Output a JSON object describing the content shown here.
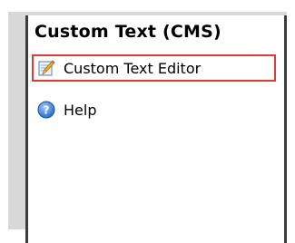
{
  "panel": {
    "title": "Custom Text (CMS)"
  },
  "menu": {
    "items": [
      {
        "label": "Custom Text Editor",
        "icon": "pencil-edit-icon",
        "selected": true
      },
      {
        "label": "Help",
        "icon": "help-icon",
        "selected": false
      }
    ]
  },
  "colors": {
    "selection_border": "#e03a3a",
    "panel_border": "#3c3c3c",
    "backdrop": "#d8d8d8",
    "help_icon": "#2f6fc4"
  }
}
